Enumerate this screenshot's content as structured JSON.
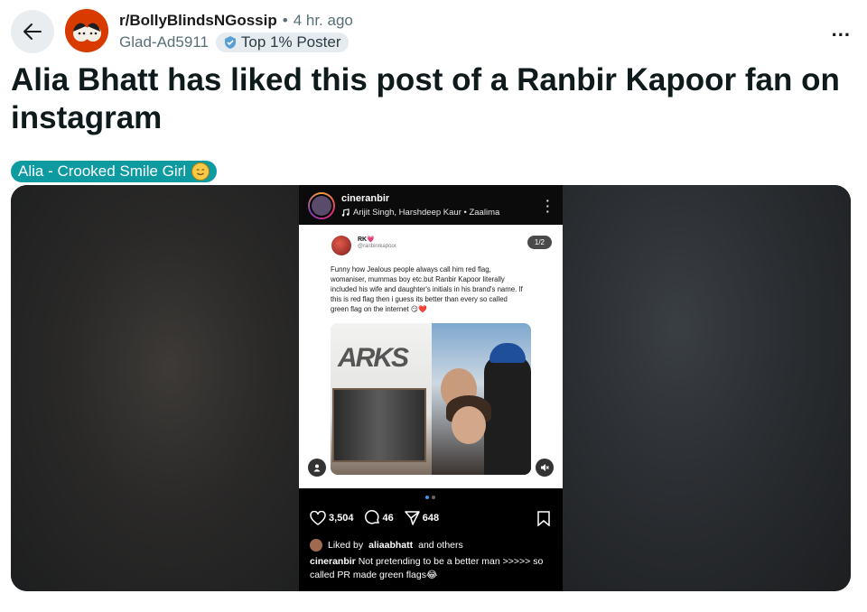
{
  "header": {
    "subreddit": "r/BollyBlindsNGossip",
    "separator": "•",
    "time": "4 hr. ago",
    "username": "Glad-Ad5911",
    "user_flair": "Top 1% Poster",
    "more_label": "..."
  },
  "post": {
    "title": "Alia Bhatt has liked this post of a Ranbir Kapoor fan on instagram",
    "flair": "Alia - Crooked Smile Girl"
  },
  "instagram": {
    "username": "cineranbir",
    "music": "Arijit Singh, Harshdeep Kaur • Zaalima",
    "tweet": {
      "name": "RK💗",
      "handle": "@ranbirxkapoor",
      "counter": "1/2",
      "text": "Funny how Jealous people always call him red flag, womaniser, mummas boy etc.but Ranbir Kapoor literally included his wife and daughter's initials in his brand's name. If this is red flag then i guess its better than every so called green flag on the internet 😏❤️",
      "store_sign": "ARKS"
    },
    "likes": "3,504",
    "comments": "46",
    "shares": "648",
    "liked_by_prefix": "Liked by",
    "liked_by_user": "aliaabhatt",
    "liked_by_suffix": "and others",
    "caption_user": "cineranbir",
    "caption_text": "Not pretending to be a better man >>>>> so called PR made green flags😂"
  },
  "colors": {
    "flair_bg": "#0d9aa1",
    "subreddit_orange": "#d93a00",
    "badge_bg": "#e5ebee"
  }
}
